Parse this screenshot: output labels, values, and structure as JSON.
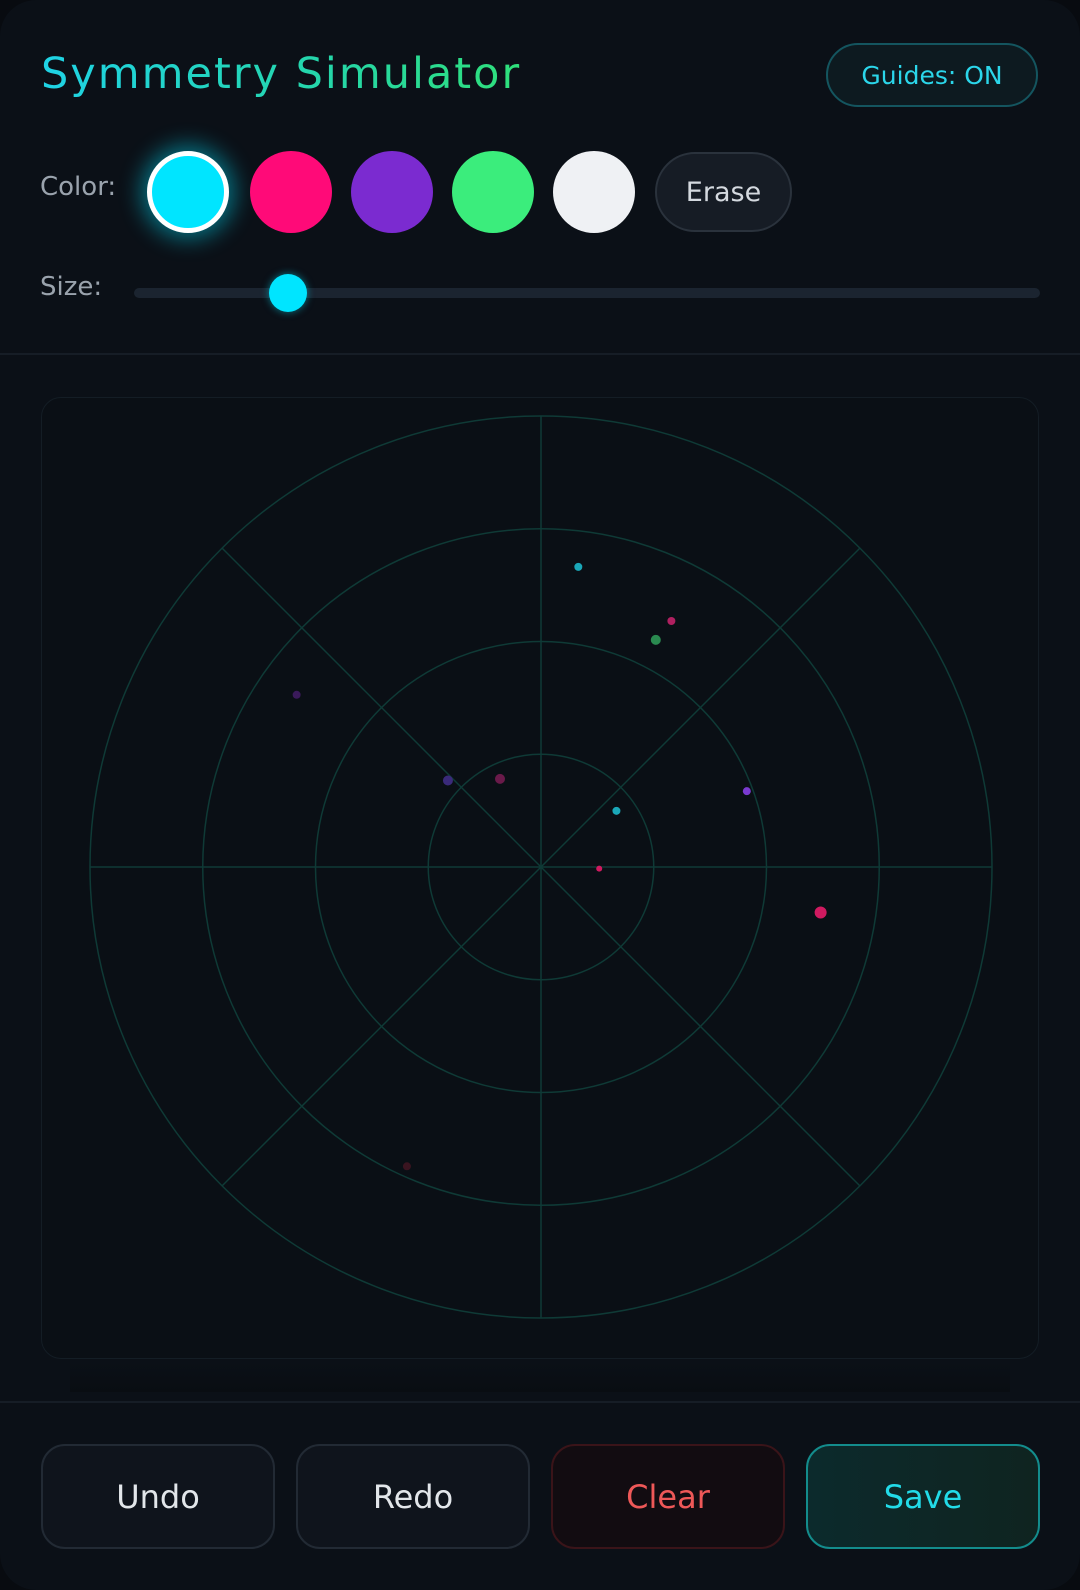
{
  "app": {
    "title": "Symmetry Simulator"
  },
  "guides": {
    "label": "Guides: ON",
    "enabled": true
  },
  "toolbar": {
    "color_label": "Color:",
    "size_label": "Size:",
    "erase_label": "Erase",
    "selected_color": "#00e5ff",
    "palette": [
      {
        "name": "cyan",
        "hex": "#00e5ff",
        "selected": true
      },
      {
        "name": "pink",
        "hex": "#ff0a78",
        "selected": false
      },
      {
        "name": "purple",
        "hex": "#7b2bd0",
        "selected": false
      },
      {
        "name": "green",
        "hex": "#3bed7c",
        "selected": false
      },
      {
        "name": "white",
        "hex": "#eff1f4",
        "selected": false
      }
    ],
    "size_value": 0.17
  },
  "canvas": {
    "symmetry_axes": 8,
    "guide_rings": 4,
    "guide_color": "#0f3a36",
    "dots": [
      {
        "color": "#1aa7b8",
        "dx": 0.091,
        "dy": -0.732,
        "r": 4
      },
      {
        "color": "#b02060",
        "dx": 0.318,
        "dy": -0.6,
        "r": 4
      },
      {
        "color": "#2a8a50",
        "dx": 0.28,
        "dy": -0.554,
        "r": 5
      },
      {
        "color": "#3a1a5a",
        "dx": -0.596,
        "dy": -0.42,
        "r": 4
      },
      {
        "color": "#3a2a7a",
        "dx": -0.227,
        "dy": -0.211,
        "r": 5
      },
      {
        "color": "#6a1a4a",
        "dx": -0.1,
        "dy": -0.215,
        "r": 5
      },
      {
        "color": "#7a3ad0",
        "dx": 0.502,
        "dy": -0.185,
        "r": 4
      },
      {
        "color": "#1aa7b8",
        "dx": 0.184,
        "dy": -0.137,
        "r": 4
      },
      {
        "color": "#d01a60",
        "dx": 0.142,
        "dy": 0.004,
        "r": 3
      },
      {
        "color": "#d01a60",
        "dx": 0.682,
        "dy": 0.111,
        "r": 6
      },
      {
        "color": "#3a1420",
        "dx": -0.327,
        "dy": 0.73,
        "r": 4
      }
    ]
  },
  "actions": {
    "undo": "Undo",
    "redo": "Redo",
    "clear": "Clear",
    "save": "Save"
  }
}
